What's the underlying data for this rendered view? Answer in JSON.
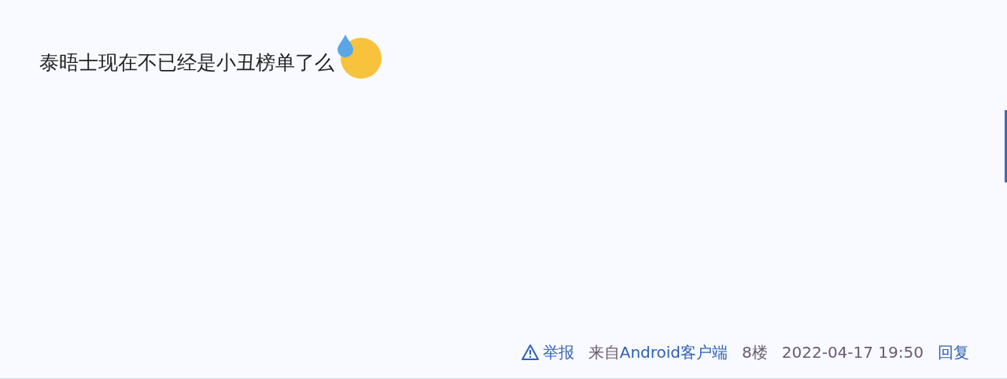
{
  "post": {
    "text": "泰晤士现在不已经是小丑榜单了么"
  },
  "footer": {
    "report": "举报",
    "source_prefix": "来自",
    "source": "Android客户端",
    "floor": "8楼",
    "time": "2022-04-17 19:50",
    "reply": "回复"
  }
}
